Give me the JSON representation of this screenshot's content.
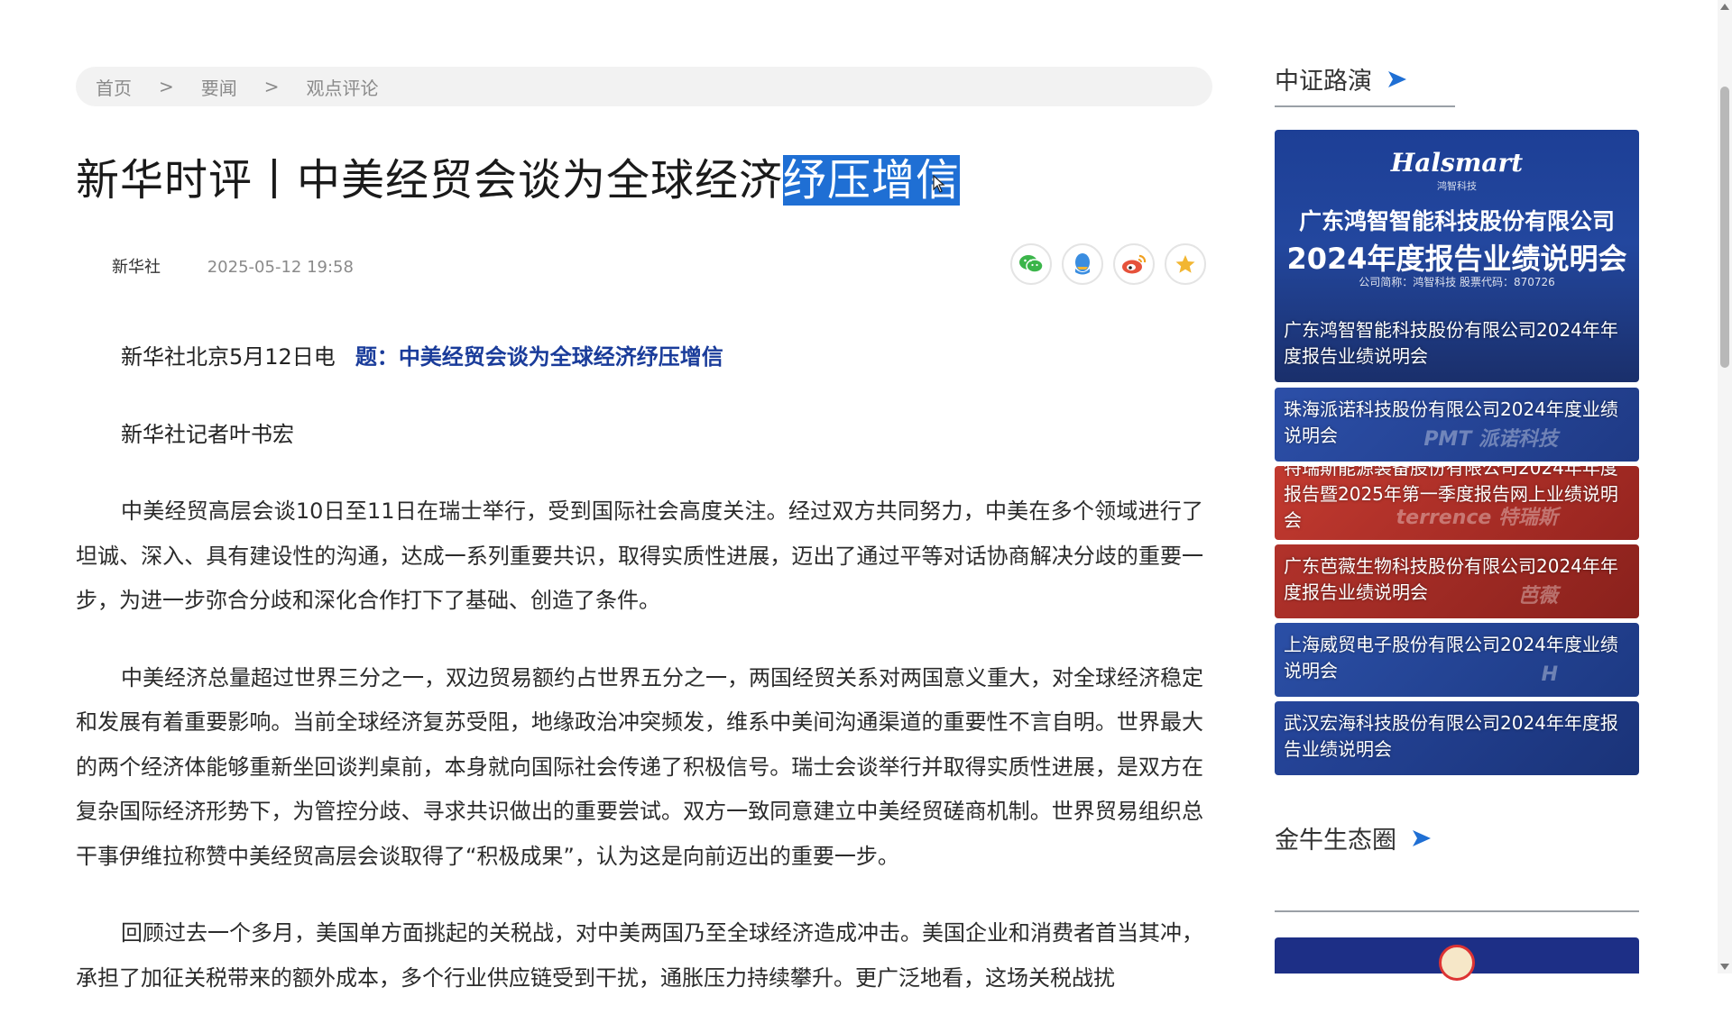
{
  "breadcrumb": {
    "items": [
      "首页",
      "要闻",
      "观点评论"
    ],
    "separator": ">"
  },
  "article": {
    "title_main": "新华时评丨中美经贸会谈为全球经济",
    "title_selected": "纾压增信",
    "source": "新华社",
    "date": "2025-05-12 19:58",
    "dateline": "新华社北京5月12日电",
    "headline_prefix": "题：",
    "headline": "中美经贸会谈为全球经济纾压增信",
    "reporter": "新华社记者叶书宏",
    "paragraphs": [
      "中美经贸高层会谈10日至11日在瑞士举行，受到国际社会高度关注。经过双方共同努力，中美在多个领域进行了坦诚、深入、具有建设性的沟通，达成一系列重要共识，取得实质性进展，迈出了通过平等对话协商解决分歧的重要一步，为进一步弥合分歧和深化合作打下了基础、创造了条件。",
      "中美经济总量超过世界三分之一，双边贸易额约占世界五分之一，两国经贸关系对两国意义重大，对全球经济稳定和发展有着重要影响。当前全球经济复苏受阻，地缘政治冲突频发，维系中美间沟通渠道的重要性不言自明。世界最大的两个经济体能够重新坐回谈判桌前，本身就向国际社会传递了积极信号。瑞士会谈举行并取得实质性进展，是双方在复杂国际经济形势下，为管控分歧、寻求共识做出的重要尝试。双方一致同意建立中美经贸磋商机制。世界贸易组织总干事伊维拉称赞中美经贸高层会谈取得了“积极成果”，认为这是向前迈出的重要一步。",
      "回顾过去一个多月，美国单方面挑起的关税战，对中美两国乃至全球经济造成冲击。美国企业和消费者首当其冲，承担了加征关税带来的额外成本，多个行业供应链受到干扰，通胀压力持续攀升。更广泛地看，这场关税战扰"
    ]
  },
  "share": {
    "icons": [
      "wechat-icon",
      "qq-icon",
      "weibo-icon",
      "favorite-icon"
    ],
    "colors": {
      "wechat": "#3bb54a",
      "qq": "#3a8de0",
      "weibo": "#e6523b",
      "favorite": "#f2b632"
    }
  },
  "sidebar": {
    "section1_title": "中证路演",
    "section2_title": "金牛生态圈",
    "banner": {
      "logo": "Halsmart",
      "logo_sub": "鸿智科技",
      "company": "广东鸿智智能科技股份有限公司",
      "event": "2024年度报告业绩说明会",
      "code_line": "公司简称：鸿智科技    股票代码：870726",
      "caption": "广东鸿智智能科技股份有限公司2024年年度报告业绩说明会"
    },
    "roadshows": [
      {
        "title": "珠海派诺科技股份有限公司2024年度业绩说明会",
        "watermark": "PMT 派诺科技",
        "color": "#2c4fa8"
      },
      {
        "title": "特瑞斯能源装备股份有限公司2024年年度报告暨2025年第一季度报告网上业绩说明会",
        "watermark": "terrence 特瑞斯",
        "color": "#b8322c"
      },
      {
        "title": "广东芭薇生物科技股份有限公司2024年年度报告业绩说明会",
        "watermark": "芭薇",
        "color": "#a42a24"
      },
      {
        "title": "上海威贸电子股份有限公司2024年度业绩说明会",
        "watermark": "H",
        "color": "#27479a"
      },
      {
        "title": "武汉宏海科技股份有限公司2024年年度报告业绩说明会",
        "watermark": "",
        "color": "#233f8e"
      }
    ]
  },
  "accent_color": "#1f6fd4"
}
